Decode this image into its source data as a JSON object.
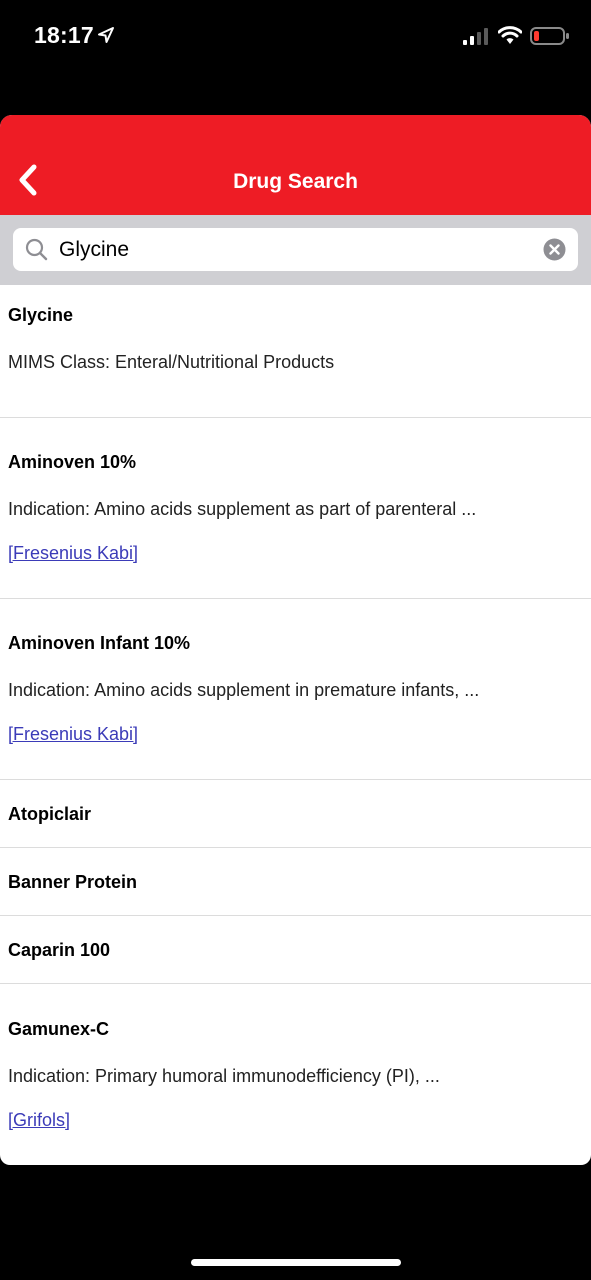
{
  "status_bar": {
    "time": "18:17"
  },
  "nav": {
    "title": "Drug Search",
    "back_icon": "chevron-left-icon",
    "color": "#ee1c25"
  },
  "search": {
    "value": "Glycine",
    "search_icon": "search-icon",
    "clear_icon": "clear-icon"
  },
  "results": [
    {
      "name": "Glycine",
      "desc": "MIMS Class: Enteral/Nutritional Products"
    },
    {
      "name": "Aminoven 10%",
      "desc": "Indication: Amino acids supplement as part of parenteral ...",
      "link": "[Fresenius Kabi]"
    },
    {
      "name": "Aminoven Infant 10%",
      "desc": "Indication: Amino acids supplement in premature infants, ...",
      "link": "[Fresenius Kabi]"
    },
    {
      "name": "Atopiclair"
    },
    {
      "name": "Banner Protein"
    },
    {
      "name": "Caparin 100"
    },
    {
      "name": "Gamunex-C",
      "desc": "Indication: Primary humoral immunodefficiency (PI), ...",
      "link": "[Grifols]"
    }
  ]
}
